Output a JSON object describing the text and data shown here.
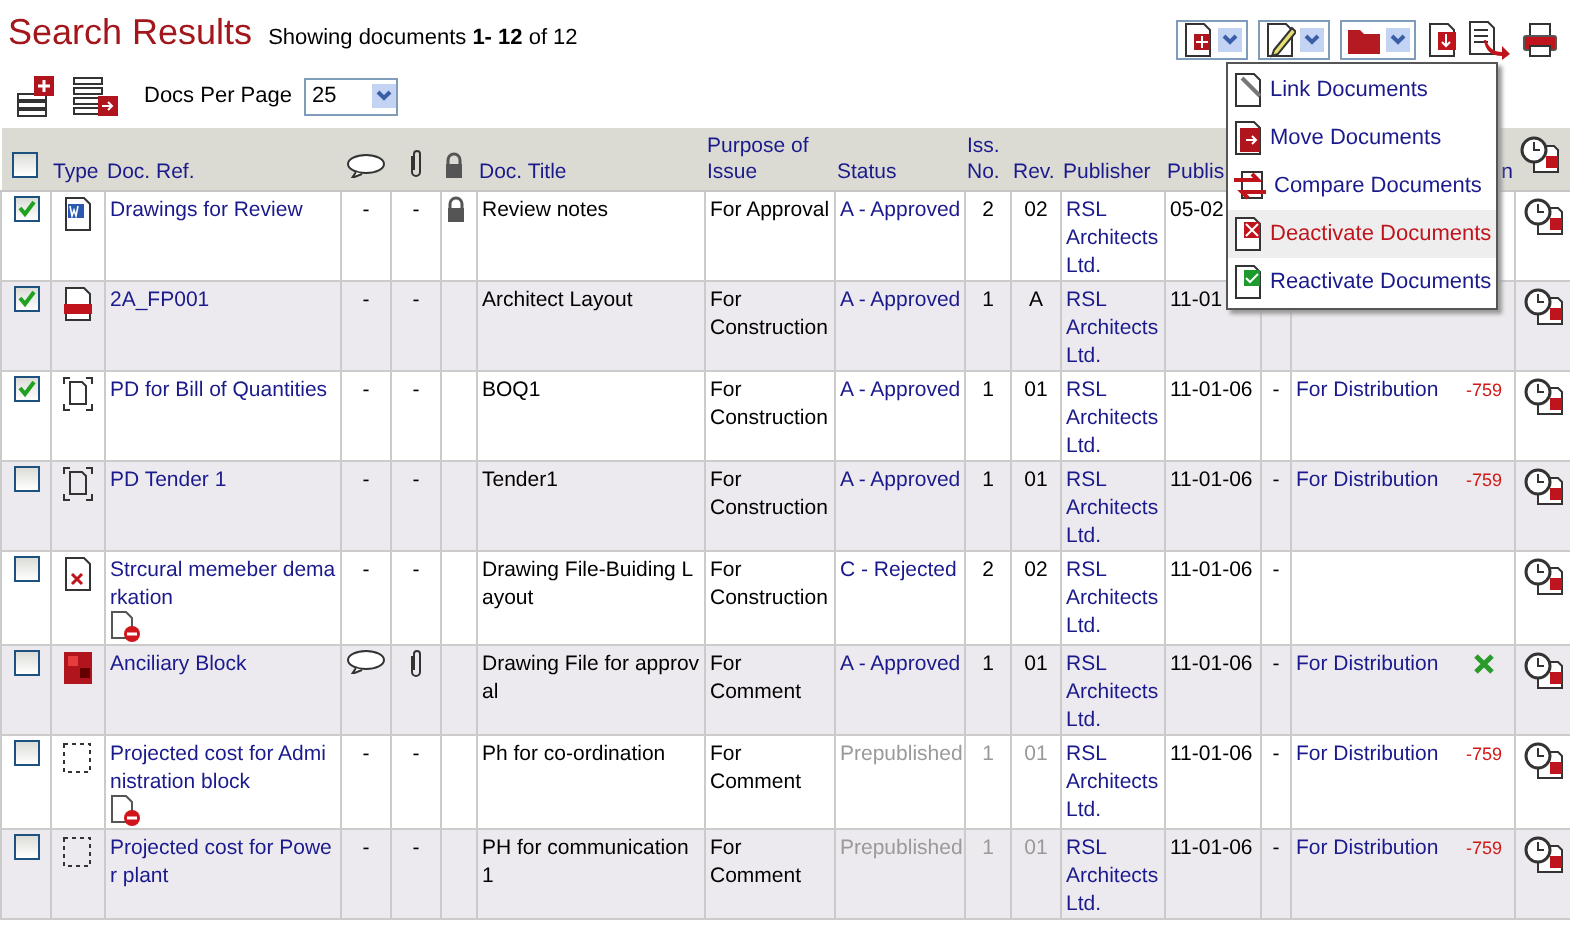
{
  "header": {
    "title": "Search Results",
    "summary": "Showing documents **1- 12** of 12"
  },
  "toolbar": {
    "docs_per_page_label": "Docs Per Page",
    "docs_per_page": "25"
  },
  "actions": [
    {
      "kind": "new-dropdown"
    },
    {
      "kind": "edit-dropdown"
    },
    {
      "kind": "folder-dropdown"
    },
    {
      "kind": "download"
    },
    {
      "kind": "export"
    },
    {
      "kind": "print"
    }
  ],
  "menu": {
    "items": [
      {
        "label": "Link Documents",
        "kind": "link",
        "selected": false
      },
      {
        "label": "Move Documents",
        "kind": "move",
        "selected": false
      },
      {
        "label": "Compare Documents",
        "kind": "compare",
        "selected": false
      },
      {
        "label": "Deactivate Documents",
        "kind": "deactivate",
        "selected": true
      },
      {
        "label": "Reactivate Documents",
        "kind": "reactivate",
        "selected": false
      }
    ]
  },
  "table": {
    "columns": [
      {
        "kind": "checkbox",
        "checked": false
      },
      {
        "kind": "text",
        "label": "Type"
      },
      {
        "kind": "text",
        "label": "Doc. Ref."
      },
      {
        "kind": "comment"
      },
      {
        "kind": "attachment"
      },
      {
        "kind": "lock"
      },
      {
        "kind": "text",
        "label": "Doc. Title"
      },
      {
        "kind": "text",
        "label": "Purpose of Issue"
      },
      {
        "kind": "text",
        "label": "Status"
      },
      {
        "kind": "text",
        "label": "Iss. No."
      },
      {
        "kind": "text",
        "label": "Rev."
      },
      {
        "kind": "text",
        "label": "Publisher"
      },
      {
        "kind": "text",
        "label": "Publis"
      },
      {
        "kind": "blank"
      },
      {
        "kind": "end",
        "label": "n"
      },
      {
        "kind": "history"
      }
    ],
    "rows": [
      {
        "checked": true,
        "kind": "word",
        "ref": "Drawings for Review",
        "removed": false,
        "comment": "-",
        "has_comment": false,
        "attachment": "-",
        "has_attachment": false,
        "locked": true,
        "title": "Review notes",
        "purpose": "For Approval",
        "status": "A - Approved",
        "greyed": false,
        "iss": "2",
        "rev": "02",
        "publisher": "RSL Architects Ltd.",
        "date": "05-02"
      },
      {
        "checked": true,
        "kind": "dgn",
        "ref": "2A_FP001",
        "removed": false,
        "comment": "-",
        "has_comment": false,
        "attachment": "-",
        "has_attachment": false,
        "locked": false,
        "title": "Architect Layout",
        "purpose": "For Construction",
        "status": "A - Approved",
        "greyed": false,
        "iss": "1",
        "rev": "A",
        "publisher": "RSL Architects Ltd.",
        "date": "11-01"
      },
      {
        "checked": true,
        "kind": "placeholder",
        "ref": "PD for Bill of Quantities",
        "removed": false,
        "comment": "-",
        "has_comment": false,
        "attachment": "-",
        "has_attachment": false,
        "locked": false,
        "title": "BOQ1",
        "purpose": "For Construction",
        "status": "A - Approved",
        "greyed": false,
        "iss": "1",
        "rev": "01",
        "publisher": "RSL Architects Ltd.",
        "date": "11-01-06",
        "dash": "-",
        "distribution": "For Distribution",
        "marker": {
          "kind": "number",
          "text": "-759"
        }
      },
      {
        "checked": false,
        "kind": "placeholder",
        "ref": "PD Tender 1",
        "removed": false,
        "comment": "-",
        "has_comment": false,
        "attachment": "-",
        "has_attachment": false,
        "locked": false,
        "title": "Tender1",
        "purpose": "For Construction",
        "status": "A - Approved",
        "greyed": false,
        "iss": "1",
        "rev": "01",
        "publisher": "RSL Architects Ltd.",
        "date": "11-01-06",
        "dash": "-",
        "distribution": "For Distribution",
        "marker": {
          "kind": "number",
          "text": "-759"
        }
      },
      {
        "checked": false,
        "kind": "broken",
        "ref": "Strcural memeber demarkation",
        "removed": true,
        "comment": "-",
        "has_comment": false,
        "attachment": "-",
        "has_attachment": false,
        "locked": false,
        "title": "Drawing File-Buiding Layout",
        "purpose": "For Construction",
        "status": "C - Rejected",
        "greyed": false,
        "iss": "2",
        "rev": "02",
        "publisher": "RSL Architects Ltd.",
        "date": "11-01-06",
        "dash": "-"
      },
      {
        "checked": false,
        "kind": "image",
        "ref": "Anciliary Block",
        "removed": false,
        "has_comment": true,
        "has_attachment": true,
        "locked": false,
        "title": "Drawing File for approval",
        "purpose": "For Comment",
        "status": "A - Approved",
        "greyed": false,
        "iss": "1",
        "rev": "01",
        "publisher": "RSL Architects Ltd.",
        "date": "11-01-06",
        "dash": "-",
        "distribution": "For Distribution",
        "marker": {
          "kind": "cross"
        }
      },
      {
        "checked": false,
        "kind": "empty",
        "ref": "Projected cost for Administration block",
        "removed": true,
        "comment": "-",
        "has_comment": false,
        "attachment": "-",
        "has_attachment": false,
        "locked": false,
        "title": "Ph for co-ordination",
        "purpose": "For Comment",
        "status": "Prepublished",
        "greyed": true,
        "iss": "1",
        "rev": "01",
        "publisher": "RSL Architects Ltd.",
        "date": "11-01-06",
        "dash": "-",
        "distribution": "For Distribution",
        "marker": {
          "kind": "number",
          "text": "-759"
        }
      },
      {
        "checked": false,
        "kind": "empty",
        "ref": "Projected cost for Power plant",
        "removed": false,
        "comment": "-",
        "has_comment": false,
        "attachment": "-",
        "has_attachment": false,
        "locked": false,
        "title": "PH for communication1",
        "purpose": "For Comment",
        "status": "Prepublished",
        "greyed": true,
        "iss": "1",
        "rev": "01",
        "publisher": "RSL Architects Ltd.",
        "date": "11-01-06",
        "dash": "-",
        "distribution": "For Distribution",
        "marker": {
          "kind": "number",
          "text": "-759"
        }
      }
    ]
  }
}
